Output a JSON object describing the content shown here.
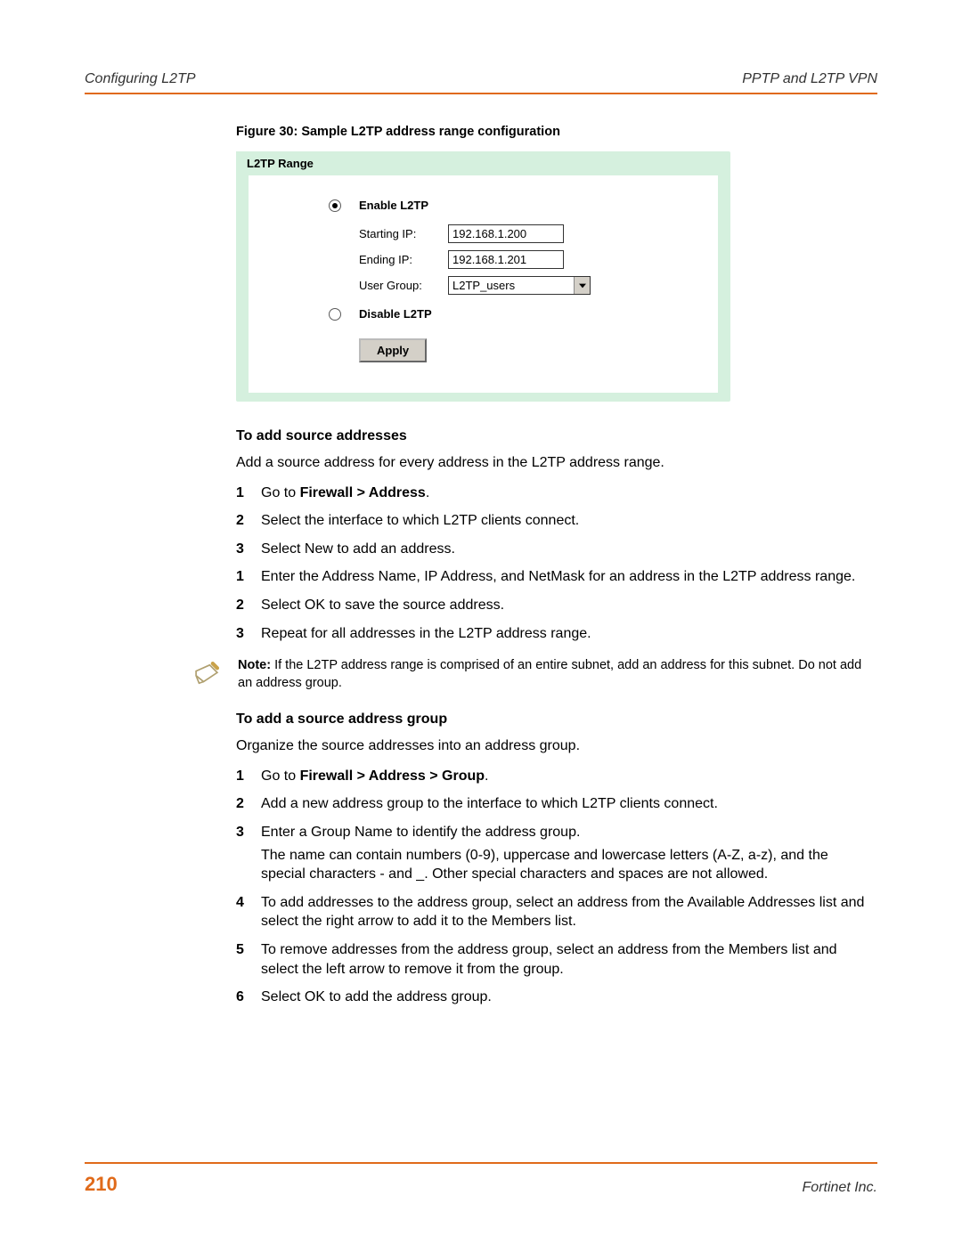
{
  "header": {
    "left": "Configuring L2TP",
    "right": "PPTP and L2TP VPN"
  },
  "caption": "Figure 30: Sample L2TP address range configuration",
  "screenshot": {
    "tab": "L2TP Range",
    "enable_label": "Enable L2TP",
    "disable_label": "Disable L2TP",
    "fields": {
      "starting_ip_label": "Starting IP:",
      "starting_ip_value": "192.168.1.200",
      "ending_ip_label": "Ending IP:",
      "ending_ip_value": "192.168.1.201",
      "user_group_label": "User Group:",
      "user_group_value": "L2TP_users"
    },
    "apply": "Apply"
  },
  "sectionA": {
    "title": "To add source addresses",
    "intro": "Add a source address for every address in the L2TP address range.",
    "steps": [
      {
        "n": "1",
        "pre": "Go to ",
        "bold": "Firewall > Address",
        "post": "."
      },
      {
        "n": "2",
        "text": "Select the interface to which L2TP clients connect."
      },
      {
        "n": "3",
        "text": "Select New to add an address."
      },
      {
        "n": "1",
        "text": "Enter the Address Name, IP Address, and NetMask for an address in the L2TP address range."
      },
      {
        "n": "2",
        "text": "Select OK to save the source address."
      },
      {
        "n": "3",
        "text": "Repeat for all addresses in the L2TP address range."
      }
    ]
  },
  "note": {
    "bold": "Note:",
    "text": " If the L2TP address range is comprised of an entire subnet, add an address for this subnet. Do not add an address group."
  },
  "sectionB": {
    "title": "To add a source address group",
    "intro": "Organize the source addresses into an address group.",
    "steps": [
      {
        "n": "1",
        "pre": "Go to ",
        "bold": "Firewall > Address > Group",
        "post": "."
      },
      {
        "n": "2",
        "text": "Add a new address group to the interface to which L2TP clients connect."
      },
      {
        "n": "3",
        "text": "Enter a Group Name to identify the address group.",
        "extra": "The name can contain numbers (0-9), uppercase and lowercase letters (A-Z, a-z), and the special characters - and _. Other special characters and spaces are not allowed."
      },
      {
        "n": "4",
        "text": "To add addresses to the address group, select an address from the Available Addresses list and select the right arrow to add it to the Members list."
      },
      {
        "n": "5",
        "text": "To remove addresses from the address group, select an address from the Members list and select the left arrow to remove it from the group."
      },
      {
        "n": "6",
        "text": "Select OK to add the address group."
      }
    ]
  },
  "footer": {
    "page": "210",
    "company": "Fortinet Inc."
  }
}
